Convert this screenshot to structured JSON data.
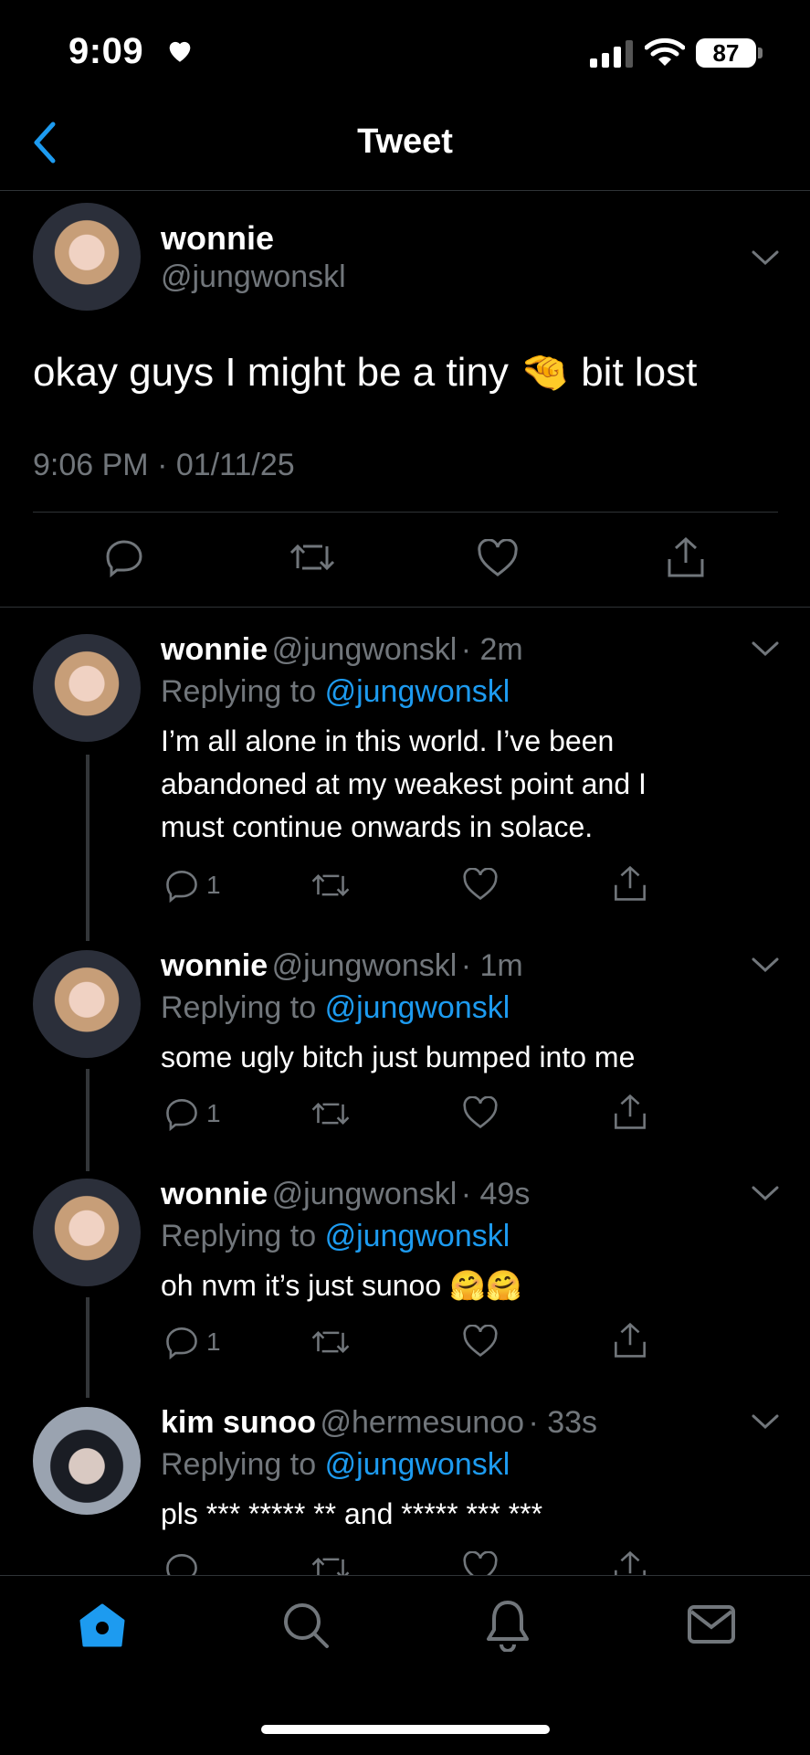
{
  "status_bar": {
    "time": "9:09",
    "battery": "87"
  },
  "header": {
    "title": "Tweet"
  },
  "main_tweet": {
    "name": "wonnie",
    "handle": "@jungwonskl",
    "text_before": "okay guys I might be a tiny",
    "emoji": "🤏",
    "text_after": "bit lost",
    "timestamp": "9:06 PM · 01/11/25"
  },
  "replies": [
    {
      "name": "wonnie",
      "handle": "@jungwonskl",
      "time": "· 2m",
      "replying_label": "Replying to",
      "replying_to": "@jungwonskl",
      "lines": [
        "I’m all alone in this world. I’ve been",
        "abandoned at my weakest point and I",
        "must continue onwards in solace."
      ],
      "reply_count": "1"
    },
    {
      "name": "wonnie",
      "handle": "@jungwonskl",
      "time": "· 1m",
      "replying_label": "Replying to",
      "replying_to": "@jungwonskl",
      "lines": [
        "some ugly bitch just bumped into me"
      ],
      "reply_count": "1"
    },
    {
      "name": "wonnie",
      "handle": "@jungwonskl",
      "time": "· 49s",
      "replying_label": "Replying to",
      "replying_to": "@jungwonskl",
      "lines": [
        "oh nvm it’s just sunoo 🤗🤗"
      ],
      "reply_count": "1"
    },
    {
      "name": "kim sunoo",
      "handle": "@hermesunoo",
      "time": "· 33s",
      "replying_label": "Replying to",
      "replying_to": "@jungwonskl",
      "lines": [
        "pls *** ***** ** and ***** *** ***"
      ],
      "reply_count": ""
    }
  ],
  "colors": {
    "accent": "#1d9bf0",
    "muted": "#71767b",
    "background": "#000000"
  },
  "icons": [
    "heart-icon",
    "cellular-signal-icon",
    "wifi-icon",
    "back-chevron-icon",
    "chevron-down-icon",
    "reply-icon",
    "retweet-icon",
    "like-icon",
    "share-icon",
    "home-icon",
    "search-icon",
    "notifications-icon",
    "messages-icon"
  ]
}
